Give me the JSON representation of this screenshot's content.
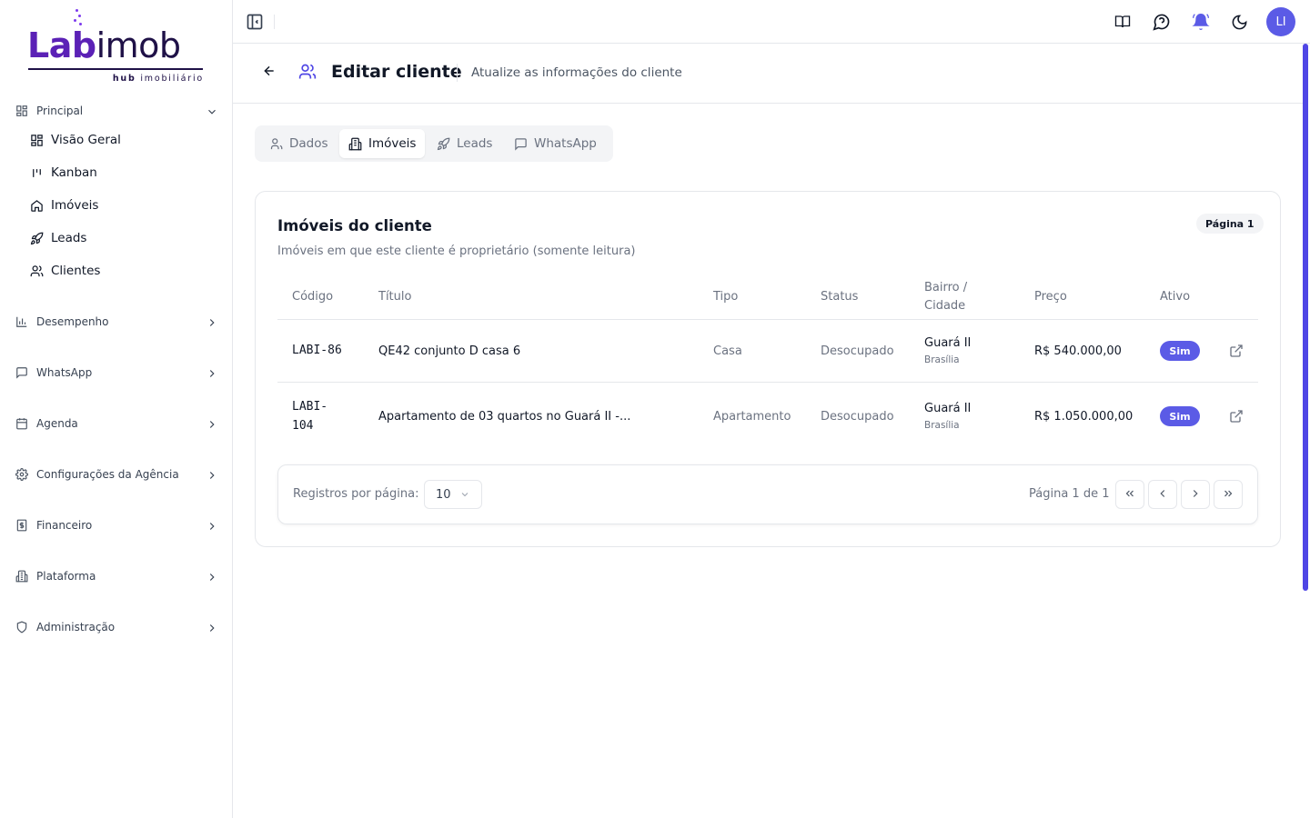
{
  "brand": {
    "logo_lab": "Lab",
    "logo_imob": "imob",
    "logo_sub_bold": "hub",
    "logo_sub": " imobiliário",
    "accent": "#5b21b6"
  },
  "sidebar": {
    "groups": [
      {
        "label": "Principal",
        "icon": "layout-grid-icon",
        "expanded": true
      },
      {
        "label": "Desempenho",
        "icon": "bar-chart-icon"
      },
      {
        "label": "WhatsApp",
        "icon": "message-square-icon"
      },
      {
        "label": "Agenda",
        "icon": "calendar-icon"
      },
      {
        "label": "Configurações da Agência",
        "icon": "gear-icon"
      },
      {
        "label": "Financeiro",
        "icon": "dollar-receipt-icon"
      },
      {
        "label": "Plataforma",
        "icon": "building-icon"
      },
      {
        "label": "Administração",
        "icon": "shield-icon"
      }
    ],
    "principal_items": [
      {
        "label": "Visão Geral",
        "icon": "layout-grid-icon"
      },
      {
        "label": "Kanban",
        "icon": "kanban-icon"
      },
      {
        "label": "Imóveis",
        "icon": "home-icon"
      },
      {
        "label": "Leads",
        "icon": "rocket-icon"
      },
      {
        "label": "Clientes",
        "icon": "users-icon"
      }
    ]
  },
  "topbar": {
    "icons": [
      "book-icon",
      "help-chat-icon",
      "bell-ringing-icon",
      "moon-icon"
    ],
    "avatar_initials": "LI",
    "avatar_color": "#5b5be6"
  },
  "header": {
    "title": "Editar cliente",
    "subtitle": "Atualize as informações do cliente"
  },
  "tabs": [
    {
      "label": "Dados",
      "icon": "user-icon",
      "active": false
    },
    {
      "label": "Imóveis",
      "icon": "building-icon",
      "active": true
    },
    {
      "label": "Leads",
      "icon": "rocket-icon",
      "active": false
    },
    {
      "label": "WhatsApp",
      "icon": "message-square-icon",
      "active": false
    }
  ],
  "card": {
    "title": "Imóveis do cliente",
    "description": "Imóveis em que este cliente é proprietário (somente leitura)",
    "page_badge": "Página 1"
  },
  "table": {
    "headers": {
      "codigo": "Código",
      "titulo": "Título",
      "tipo": "Tipo",
      "status": "Status",
      "bairro_line1": "Bairro /",
      "bairro_line2": "Cidade",
      "preco": "Preço",
      "ativo": "Ativo"
    },
    "rows": [
      {
        "codigo": "LABI-86",
        "titulo": "QE42 conjunto D casa 6",
        "tipo": "Casa",
        "status": "Desocupado",
        "bairro": "Guará II",
        "cidade": "Brasília",
        "preco": "R$ 540.000,00",
        "ativo": "Sim"
      },
      {
        "codigo_line1": "LABI-",
        "codigo_line2": "104",
        "titulo": "Apartamento de 03 quartos no Guará II -...",
        "tipo": "Apartamento",
        "status": "Desocupado",
        "bairro": "Guará II",
        "cidade": "Brasília",
        "preco": "R$ 1.050.000,00",
        "ativo": "Sim"
      }
    ]
  },
  "pagination": {
    "rows_per_page_label": "Registros por página:",
    "rows_per_page_value": "10",
    "page_info": "Página 1 de 1"
  }
}
